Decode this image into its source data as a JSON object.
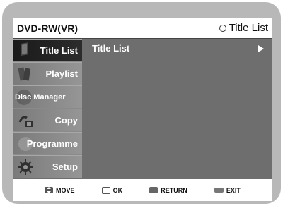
{
  "header": {
    "disc_type": "DVD-RW(VR)",
    "current_title": "Title List"
  },
  "sidebar": {
    "items": [
      {
        "label": "Title List",
        "active": true
      },
      {
        "label": "Playlist",
        "active": false
      },
      {
        "label": "Disc Manager",
        "active": false
      },
      {
        "label": "Copy",
        "active": false
      },
      {
        "label": "Programme",
        "active": false
      },
      {
        "label": "Setup",
        "active": false
      }
    ]
  },
  "content": {
    "item_label": "Title List"
  },
  "footer": {
    "move": "MOVE",
    "ok": "OK",
    "return": "RETURN",
    "exit": "EXIT"
  },
  "colors": {
    "frame": "#b8b8b8",
    "screen": "#6e6e6e",
    "active_item": "#1a1a1a",
    "text": "#ffffff"
  }
}
